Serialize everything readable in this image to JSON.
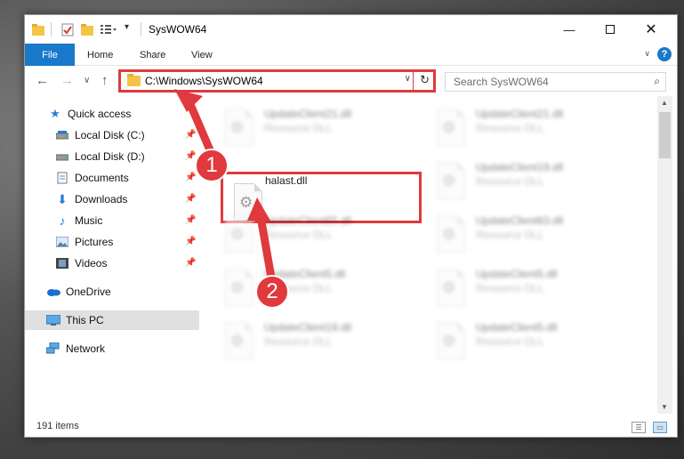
{
  "window": {
    "title": "SysWOW64",
    "quick_access_toolbar": [
      "folder-icon",
      "properties-icon",
      "new-folder-icon",
      "customize-icon"
    ],
    "controls": [
      "minimize-icon",
      "maximize-icon",
      "close-icon"
    ]
  },
  "ribbon": {
    "file": "File",
    "tabs": [
      "Home",
      "Share",
      "View"
    ],
    "help": "?"
  },
  "address": {
    "path": "C:\\Windows\\SysWOW64",
    "search_placeholder": "Search SysWOW64"
  },
  "sidebar": {
    "quick_access": "Quick access",
    "items": [
      {
        "label": "Local Disk (C:)",
        "icon": "drive-icon",
        "pinned": true
      },
      {
        "label": "Local Disk (D:)",
        "icon": "drive-icon",
        "pinned": true
      },
      {
        "label": "Documents",
        "icon": "documents-icon",
        "pinned": true
      },
      {
        "label": "Downloads",
        "icon": "downloads-icon",
        "pinned": true
      },
      {
        "label": "Music",
        "icon": "music-icon",
        "pinned": true
      },
      {
        "label": "Pictures",
        "icon": "pictures-icon",
        "pinned": true
      },
      {
        "label": "Videos",
        "icon": "videos-icon",
        "pinned": true
      }
    ],
    "onedrive": "OneDrive",
    "this_pc": "This PC",
    "network": "Network"
  },
  "files": [
    {
      "name": "UpdateClient21.dll",
      "type": "Resource DLL",
      "blurred": true
    },
    {
      "name": "UpdateClient21.dll",
      "type": "Resource DLL",
      "blurred": true
    },
    {
      "name": "halast.dll",
      "type": "",
      "blurred": false,
      "highlighted": true
    },
    {
      "name": "UpdateClient19.dll",
      "type": "Resource DLL",
      "blurred": true
    },
    {
      "name": "UpdateClient65.dll",
      "type": "Resource DLL",
      "blurred": true
    },
    {
      "name": "UpdateClient63.dll",
      "type": "Resource DLL",
      "blurred": true
    },
    {
      "name": "UpdateClient5.dll",
      "type": "Resource DLL",
      "blurred": true
    },
    {
      "name": "UpdateClient5.dll",
      "type": "Resource DLL",
      "blurred": true
    },
    {
      "name": "UpdateClient19.dll",
      "type": "Resource DLL",
      "blurred": true
    },
    {
      "name": "UpdateClient5.dll",
      "type": "Resource DLL",
      "blurred": true
    }
  ],
  "status": {
    "count": "191 items"
  },
  "annotations": {
    "step1": "1",
    "step2": "2",
    "color": "#e0393e"
  },
  "colors": {
    "accent": "#1979ca",
    "highlight": "#e0393e",
    "folder": "#f3c447"
  }
}
